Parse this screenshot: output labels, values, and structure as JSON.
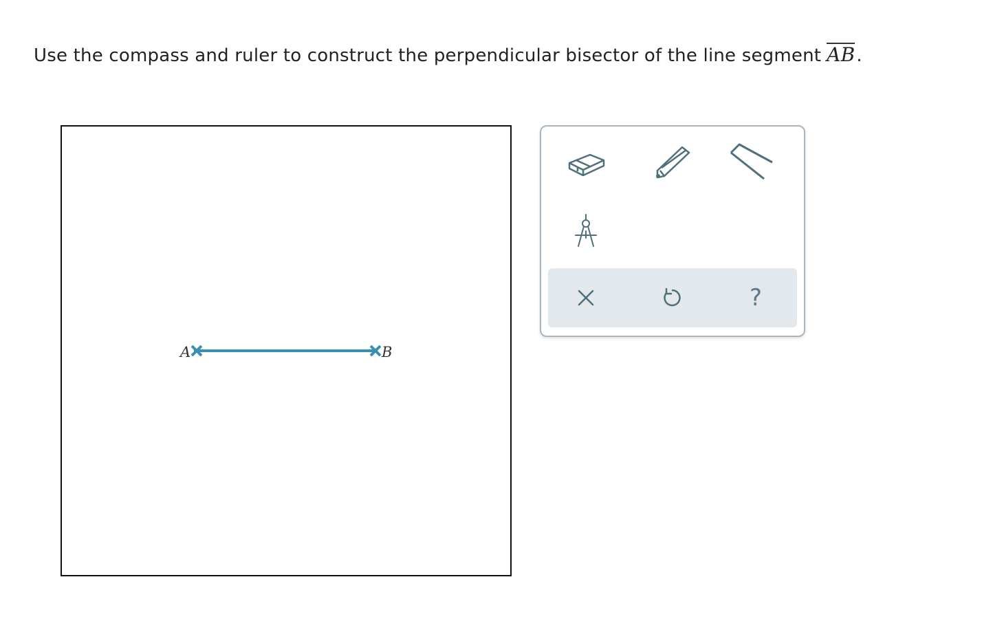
{
  "prompt": {
    "text": "Use the compass and ruler to construct the perpendicular bisector of the line segment",
    "segment_label": "AB",
    "period": "."
  },
  "canvas": {
    "point_a_label": "A",
    "point_b_label": "B",
    "segment_color": "#3a8fb0"
  },
  "toolbox": {
    "tools": [
      {
        "name": "eraser-icon",
        "label": "Eraser"
      },
      {
        "name": "pencil-icon",
        "label": "Pencil"
      },
      {
        "name": "ruler-icon",
        "label": "Ruler"
      },
      {
        "name": "compass-icon",
        "label": "Compass"
      }
    ],
    "actions": [
      {
        "name": "clear-icon",
        "label": "×"
      },
      {
        "name": "undo-icon",
        "label": "Undo"
      },
      {
        "name": "help-icon",
        "label": "?"
      }
    ],
    "icon_color": "#4e6f7c",
    "action_bar_color": "#e3e8ec"
  }
}
